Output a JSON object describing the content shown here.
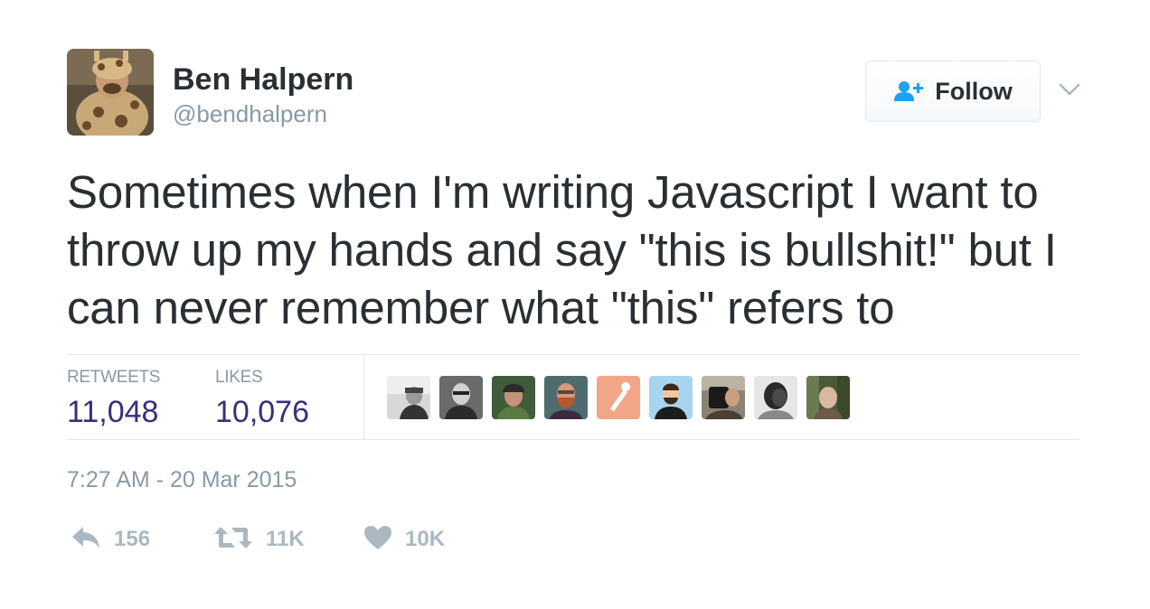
{
  "author": {
    "name": "Ben Halpern",
    "handle": "@bendhalpern"
  },
  "follow_button": {
    "label": "Follow",
    "icon": "follow-user-plus-icon"
  },
  "more_menu": {
    "icon": "chevron-down-icon"
  },
  "tweet": {
    "text": "Sometimes when I'm writing Javascript I want to throw up my hands and say \"this is bullshit!\" but I can never remember what \"this\" refers to"
  },
  "stats": {
    "retweets_label": "RETWEETS",
    "retweets_value": "11,048",
    "likes_label": "LIKES",
    "likes_value": "10,076"
  },
  "liker_avatars": [
    {
      "icon": "user-avatar"
    },
    {
      "icon": "user-avatar"
    },
    {
      "icon": "user-avatar"
    },
    {
      "icon": "user-avatar"
    },
    {
      "icon": "user-avatar"
    },
    {
      "icon": "user-avatar"
    },
    {
      "icon": "user-avatar"
    },
    {
      "icon": "user-avatar"
    },
    {
      "icon": "user-avatar"
    }
  ],
  "timestamp": "7:27 AM - 20 Mar 2015",
  "actions": {
    "reply_count": "156",
    "retweet_count": "11K",
    "like_count": "10K"
  },
  "colors": {
    "text": "#292f33",
    "muted": "#8899a6",
    "stat_value": "#3b2d78",
    "action_gray": "#aab8c2",
    "follow_blue": "#1da1f2",
    "border": "#e1e8ed"
  }
}
